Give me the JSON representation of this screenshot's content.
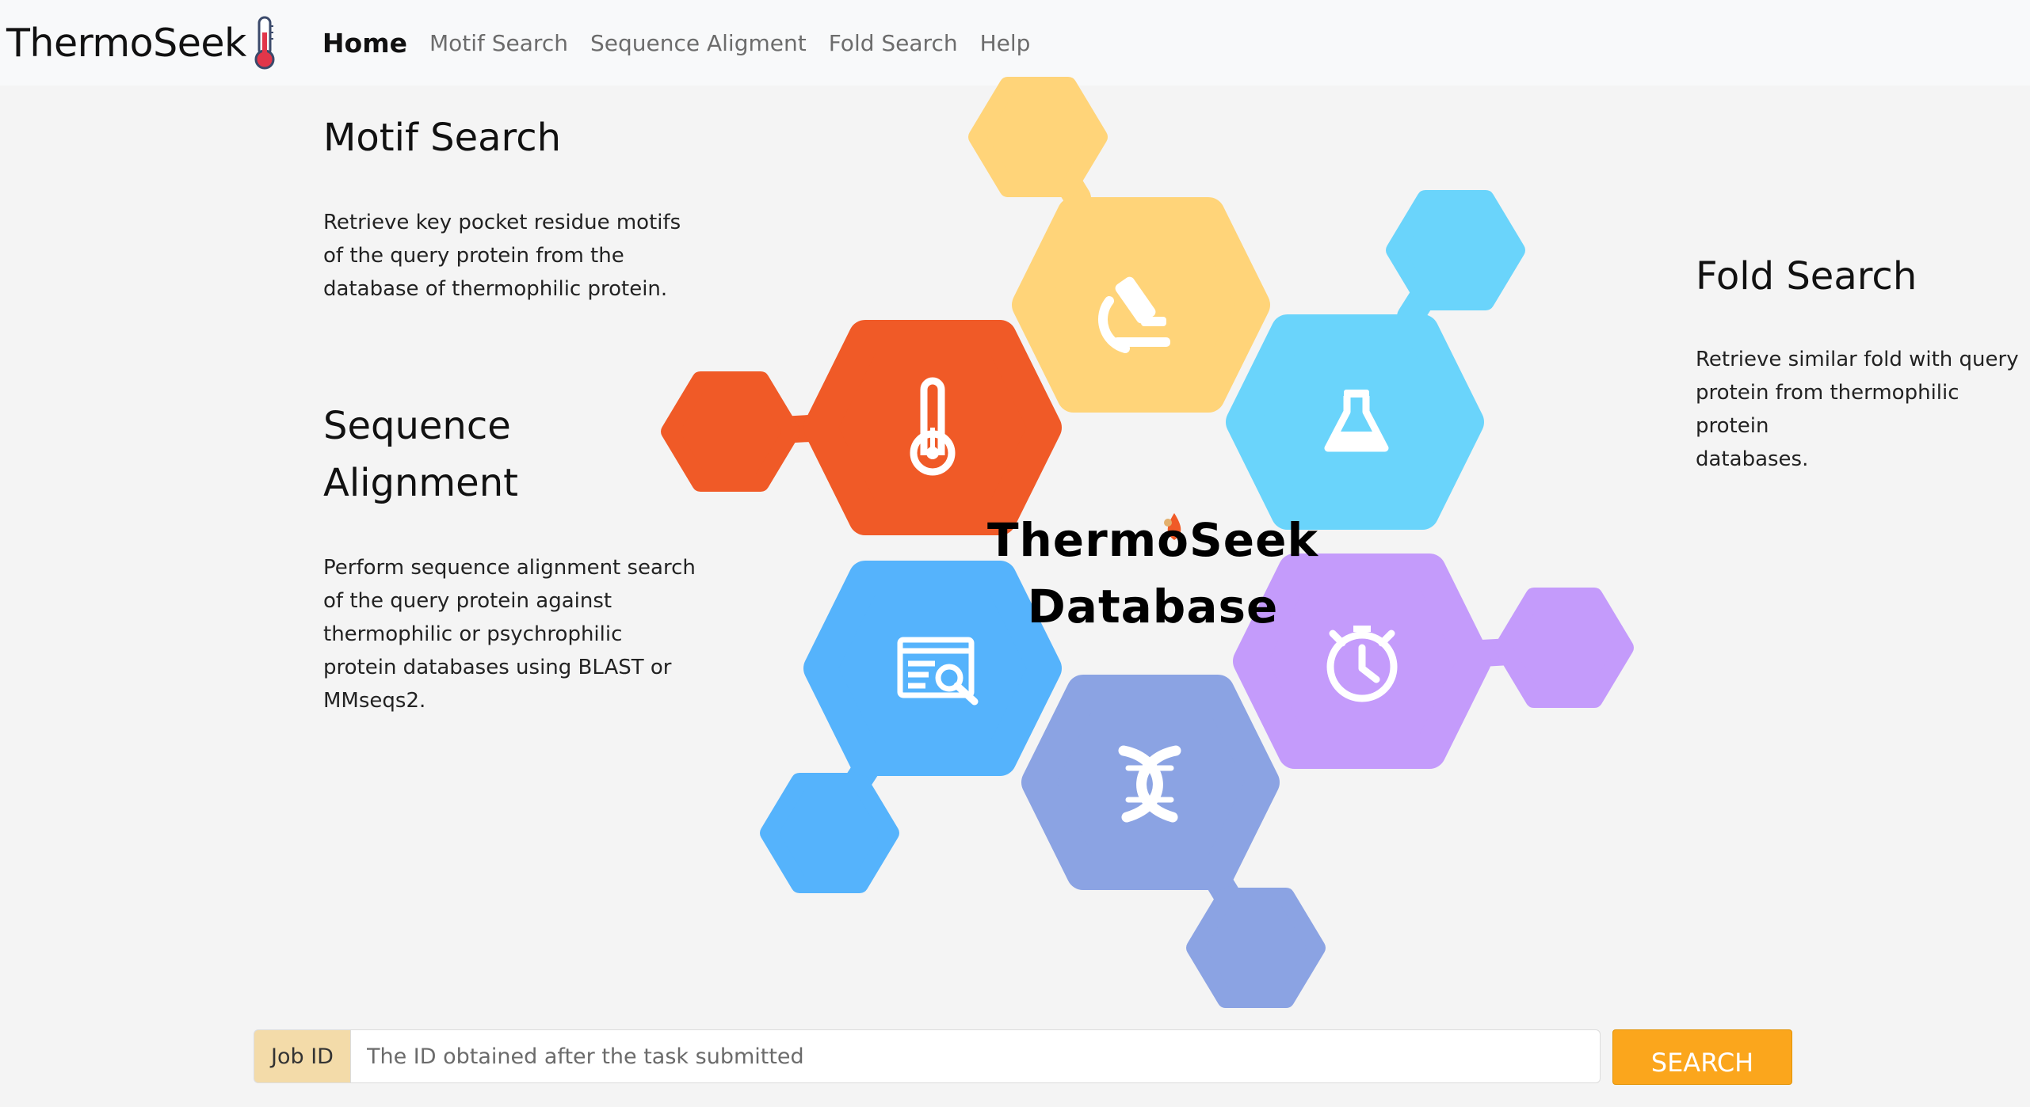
{
  "navbar": {
    "brand": "ThermoSeek",
    "items": [
      {
        "label": "Home",
        "active": true
      },
      {
        "label": "Motif Search"
      },
      {
        "label": "Sequence Aligment"
      },
      {
        "label": "Fold Search"
      },
      {
        "label": "Help"
      }
    ]
  },
  "features": {
    "motif": {
      "title": "Motif Search",
      "lines": [
        "Retrieve key pocket residue motifs",
        "of the query protein from the",
        "database of thermophilic protein."
      ]
    },
    "sequence": {
      "title_lines": [
        "Sequence",
        "Alignment"
      ],
      "lines": [
        "Perform sequence alignment search",
        "of the query protein against",
        "thermophilic or psychrophilic",
        "protein databases using BLAST or",
        "MMseqs2."
      ]
    },
    "fold": {
      "title": "Fold Search",
      "lines": [
        "Retrieve similar fold with query",
        "protein from thermophilic protein",
        "databases."
      ]
    }
  },
  "center_title": {
    "line1": "ThermoSeek",
    "line2": "Database"
  },
  "hexagons": [
    {
      "icon": "microscope-icon",
      "color": "#ffd479"
    },
    {
      "icon": "flask-icon",
      "color": "#6ad4fb"
    },
    {
      "icon": "thermometer-icon",
      "color": "#f05a27"
    },
    {
      "icon": "report-search-icon",
      "color": "#55b3fc"
    },
    {
      "icon": "stopwatch-icon",
      "color": "#c49bfb"
    },
    {
      "icon": "dna-icon",
      "color": "#8ba3e3"
    }
  ],
  "search": {
    "label": "Job ID",
    "placeholder": "The ID obtained after the task submitted",
    "value": "",
    "button": "SEARCH"
  },
  "colors": {
    "accent": "#fba61c",
    "label_bg": "#f3dba9",
    "page_bg": "#f4f4f4"
  }
}
